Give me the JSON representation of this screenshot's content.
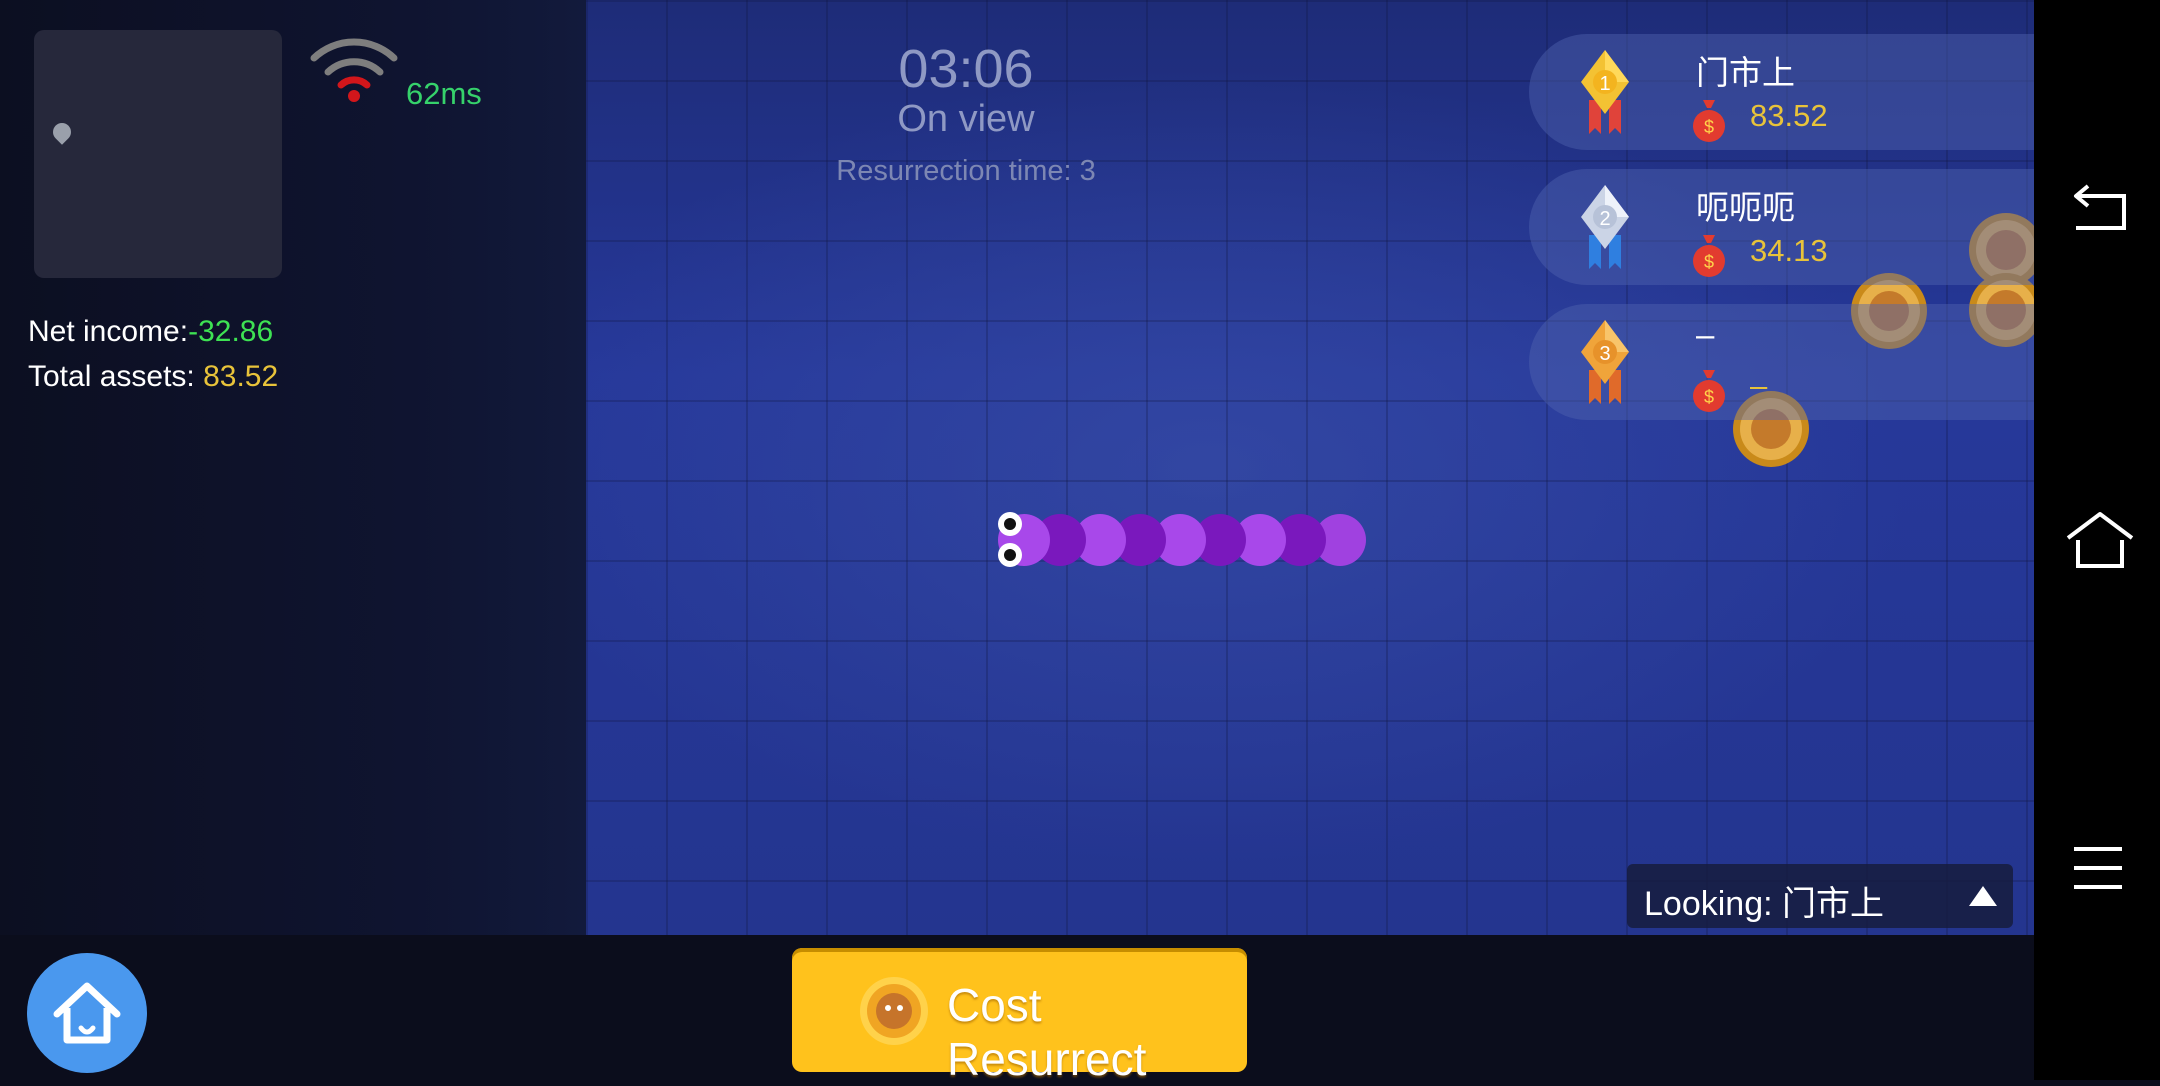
{
  "hud": {
    "ping": "62ms",
    "net_income_label": "Net income:",
    "net_income_value": "-32.86",
    "total_assets_label": "Total assets:",
    "total_assets_value": "83.52"
  },
  "match": {
    "timer": "03:06",
    "view_status": "On view",
    "resurrection_text": "Resurrection time: 3"
  },
  "leaderboard": [
    {
      "rank": "1",
      "name": "门市上",
      "score": "83.52"
    },
    {
      "rank": "2",
      "name": "呃呃呃",
      "score": "34.13"
    },
    {
      "rank": "3",
      "name": "–",
      "score": "–"
    }
  ],
  "spectate": {
    "label": "Looking: 门市上"
  },
  "resurrect_button": {
    "label": "Cost Resurrect"
  },
  "snake": {
    "color_primary": "#a848e8",
    "color_secondary": "#7a1cc0",
    "segments": 9
  },
  "icons": [
    "map-marker-icon",
    "wifi-icon",
    "home-icon",
    "medal-gold-icon",
    "medal-silver-icon",
    "medal-bronze-icon",
    "money-bag-icon",
    "coin-icon",
    "back-icon",
    "nav-home-icon",
    "menu-icon",
    "dropdown-arrow-icon"
  ]
}
